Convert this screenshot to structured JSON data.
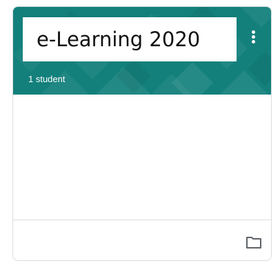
{
  "card": {
    "title": "e-Learning 2020",
    "student_count": "1 student"
  },
  "colors": {
    "banner": "#13807b",
    "text": "#111111",
    "icon": "#5f6368"
  },
  "icons": {
    "menu": "more-vert-icon",
    "folder": "folder-icon"
  }
}
